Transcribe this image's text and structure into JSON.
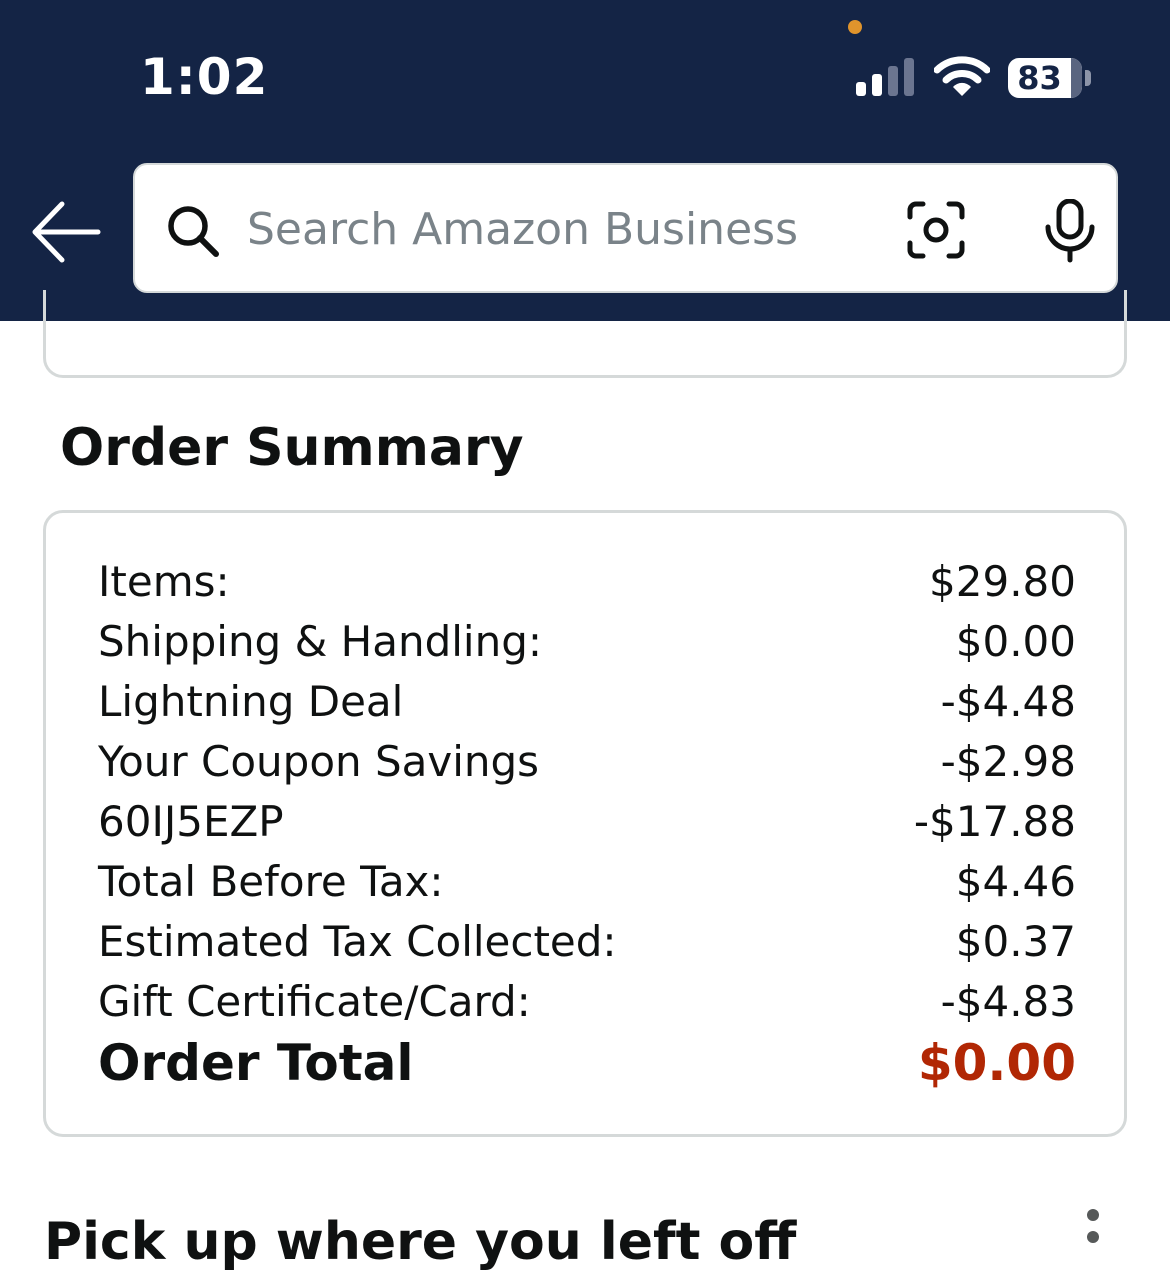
{
  "status_bar": {
    "time": "1:02",
    "battery": "83",
    "icons": [
      "privacy-dot",
      "signal-icon",
      "wifi-icon",
      "battery-icon"
    ]
  },
  "header": {
    "back_icon": "back-arrow-icon",
    "search": {
      "placeholder": "Search Amazon Business",
      "value": "",
      "icons": [
        "search-icon",
        "camera-icon",
        "mic-icon"
      ]
    }
  },
  "order_summary": {
    "title": "Order Summary",
    "rows": [
      {
        "label": "Items:",
        "value": "$29.80"
      },
      {
        "label": "Shipping & Handling:",
        "value": "$0.00"
      },
      {
        "label": "Lightning Deal",
        "value": "-$4.48"
      },
      {
        "label": "Your Coupon Savings",
        "value": "-$2.98"
      },
      {
        "label": "60IJ5EZP",
        "value": "-$17.88"
      },
      {
        "label": "Total Before Tax:",
        "value": "$4.46"
      },
      {
        "label": "Estimated Tax Collected:",
        "value": "$0.37"
      },
      {
        "label": "Gift Certificate/Card:",
        "value": "-$4.83"
      }
    ],
    "total": {
      "label": "Order Total",
      "value": "$0.00"
    }
  },
  "pickup": {
    "title": "Pick up where you left off",
    "menu_icon": "more-options-icon"
  },
  "colors": {
    "header_bg": "#142445",
    "total_price": "#b12704",
    "privacy_dot": "#e0942c",
    "card_border": "#d5d9d9"
  }
}
